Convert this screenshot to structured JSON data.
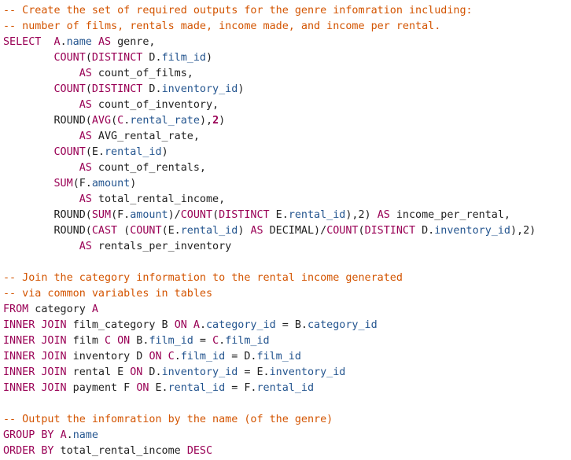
{
  "colors": {
    "keyword": "#990055",
    "comment": "#d35400",
    "field": "#24558f",
    "plain": "#1f1f1f",
    "background": "#ffffff"
  },
  "lines": [
    [
      {
        "t": "cm",
        "v": "-- Create the set of required outputs for the genre infomration including:"
      }
    ],
    [
      {
        "t": "cm",
        "v": "-- number of films, rentals made, income made, and income per rental."
      }
    ],
    [
      {
        "t": "kw",
        "v": "SELECT"
      },
      {
        "t": "pl",
        "v": "  "
      },
      {
        "t": "al",
        "v": "A"
      },
      {
        "t": "pl",
        "v": "."
      },
      {
        "t": "fd",
        "v": "name"
      },
      {
        "t": "pl",
        "v": " "
      },
      {
        "t": "kw",
        "v": "AS"
      },
      {
        "t": "pl",
        "v": " genre,"
      }
    ],
    [
      {
        "t": "pl",
        "v": "        "
      },
      {
        "t": "kw",
        "v": "COUNT"
      },
      {
        "t": "pl",
        "v": "("
      },
      {
        "t": "kw",
        "v": "DISTINCT"
      },
      {
        "t": "pl",
        "v": " D."
      },
      {
        "t": "fd",
        "v": "film_id"
      },
      {
        "t": "pl",
        "v": ")"
      }
    ],
    [
      {
        "t": "pl",
        "v": "            "
      },
      {
        "t": "kw",
        "v": "AS"
      },
      {
        "t": "pl",
        "v": " count_of_films,"
      }
    ],
    [
      {
        "t": "pl",
        "v": "        "
      },
      {
        "t": "kw",
        "v": "COUNT"
      },
      {
        "t": "pl",
        "v": "("
      },
      {
        "t": "kw",
        "v": "DISTINCT"
      },
      {
        "t": "pl",
        "v": " D."
      },
      {
        "t": "fd",
        "v": "inventory_id"
      },
      {
        "t": "pl",
        "v": ")"
      }
    ],
    [
      {
        "t": "pl",
        "v": "            "
      },
      {
        "t": "kw",
        "v": "AS"
      },
      {
        "t": "pl",
        "v": " count_of_inventory,"
      }
    ],
    [
      {
        "t": "pl",
        "v": "        ROUND("
      },
      {
        "t": "kw",
        "v": "AVG"
      },
      {
        "t": "pl",
        "v": "("
      },
      {
        "t": "al",
        "v": "C"
      },
      {
        "t": "pl",
        "v": "."
      },
      {
        "t": "fd",
        "v": "rental_rate"
      },
      {
        "t": "pl",
        "v": "),"
      },
      {
        "t": "nm",
        "v": "2"
      },
      {
        "t": "pl",
        "v": ")"
      }
    ],
    [
      {
        "t": "pl",
        "v": "            "
      },
      {
        "t": "kw",
        "v": "AS"
      },
      {
        "t": "pl",
        "v": " AVG_rental_rate,"
      }
    ],
    [
      {
        "t": "pl",
        "v": "        "
      },
      {
        "t": "kw",
        "v": "COUNT"
      },
      {
        "t": "pl",
        "v": "(E."
      },
      {
        "t": "fd",
        "v": "rental_id"
      },
      {
        "t": "pl",
        "v": ")"
      }
    ],
    [
      {
        "t": "pl",
        "v": "            "
      },
      {
        "t": "kw",
        "v": "AS"
      },
      {
        "t": "pl",
        "v": " count_of_rentals,"
      }
    ],
    [
      {
        "t": "pl",
        "v": "        "
      },
      {
        "t": "kw",
        "v": "SUM"
      },
      {
        "t": "pl",
        "v": "(F."
      },
      {
        "t": "fd",
        "v": "amount"
      },
      {
        "t": "pl",
        "v": ")"
      }
    ],
    [
      {
        "t": "pl",
        "v": "            "
      },
      {
        "t": "kw",
        "v": "AS"
      },
      {
        "t": "pl",
        "v": " total_rental_income,"
      }
    ],
    [
      {
        "t": "pl",
        "v": "        ROUND("
      },
      {
        "t": "kw",
        "v": "SUM"
      },
      {
        "t": "pl",
        "v": "(F."
      },
      {
        "t": "fd",
        "v": "amount"
      },
      {
        "t": "pl",
        "v": ")/"
      },
      {
        "t": "kw",
        "v": "COUNT"
      },
      {
        "t": "pl",
        "v": "("
      },
      {
        "t": "kw",
        "v": "DISTINCT"
      },
      {
        "t": "pl",
        "v": " E."
      },
      {
        "t": "fd",
        "v": "rental_id"
      },
      {
        "t": "pl",
        "v": "),2) "
      },
      {
        "t": "kw",
        "v": "AS"
      },
      {
        "t": "pl",
        "v": " income_per_rental,"
      }
    ],
    [
      {
        "t": "pl",
        "v": "        ROUND("
      },
      {
        "t": "kw",
        "v": "CAST"
      },
      {
        "t": "pl",
        "v": " ("
      },
      {
        "t": "kw",
        "v": "COUNT"
      },
      {
        "t": "pl",
        "v": "(E."
      },
      {
        "t": "fd",
        "v": "rental_id"
      },
      {
        "t": "pl",
        "v": ") "
      },
      {
        "t": "kw",
        "v": "AS"
      },
      {
        "t": "pl",
        "v": " DECIMAL)/"
      },
      {
        "t": "kw",
        "v": "COUNT"
      },
      {
        "t": "pl",
        "v": "("
      },
      {
        "t": "kw",
        "v": "DISTINCT"
      },
      {
        "t": "pl",
        "v": " D."
      },
      {
        "t": "fd",
        "v": "inventory_id"
      },
      {
        "t": "pl",
        "v": "),2)"
      }
    ],
    [
      {
        "t": "pl",
        "v": "            "
      },
      {
        "t": "kw",
        "v": "AS"
      },
      {
        "t": "pl",
        "v": " rentals_per_inventory"
      }
    ],
    [],
    [
      {
        "t": "cm",
        "v": "-- Join the category information to the rental income generated"
      }
    ],
    [
      {
        "t": "cm",
        "v": "-- via common variables in tables"
      }
    ],
    [
      {
        "t": "kw",
        "v": "FROM"
      },
      {
        "t": "pl",
        "v": " category "
      },
      {
        "t": "kw",
        "v": "A"
      }
    ],
    [
      {
        "t": "kw",
        "v": "INNER JOIN"
      },
      {
        "t": "pl",
        "v": " film_category B "
      },
      {
        "t": "kw",
        "v": "ON"
      },
      {
        "t": "pl",
        "v": " "
      },
      {
        "t": "al",
        "v": "A"
      },
      {
        "t": "pl",
        "v": "."
      },
      {
        "t": "fd",
        "v": "category_id"
      },
      {
        "t": "pl",
        "v": " = B."
      },
      {
        "t": "fd",
        "v": "category_id"
      }
    ],
    [
      {
        "t": "kw",
        "v": "INNER JOIN"
      },
      {
        "t": "pl",
        "v": " film "
      },
      {
        "t": "kw",
        "v": "C"
      },
      {
        "t": "pl",
        "v": " "
      },
      {
        "t": "kw",
        "v": "ON"
      },
      {
        "t": "pl",
        "v": " B."
      },
      {
        "t": "fd",
        "v": "film_id"
      },
      {
        "t": "pl",
        "v": " = "
      },
      {
        "t": "al",
        "v": "C"
      },
      {
        "t": "pl",
        "v": "."
      },
      {
        "t": "fd",
        "v": "film_id"
      }
    ],
    [
      {
        "t": "kw",
        "v": "INNER JOIN"
      },
      {
        "t": "pl",
        "v": " inventory D "
      },
      {
        "t": "kw",
        "v": "ON"
      },
      {
        "t": "pl",
        "v": " "
      },
      {
        "t": "al",
        "v": "C"
      },
      {
        "t": "pl",
        "v": "."
      },
      {
        "t": "fd",
        "v": "film_id"
      },
      {
        "t": "pl",
        "v": " = D."
      },
      {
        "t": "fd",
        "v": "film_id"
      }
    ],
    [
      {
        "t": "kw",
        "v": "INNER JOIN"
      },
      {
        "t": "pl",
        "v": " rental E "
      },
      {
        "t": "kw",
        "v": "ON"
      },
      {
        "t": "pl",
        "v": " D."
      },
      {
        "t": "fd",
        "v": "inventory_id"
      },
      {
        "t": "pl",
        "v": " = E."
      },
      {
        "t": "fd",
        "v": "inventory_id"
      }
    ],
    [
      {
        "t": "kw",
        "v": "INNER JOIN"
      },
      {
        "t": "pl",
        "v": " payment F "
      },
      {
        "t": "kw",
        "v": "ON"
      },
      {
        "t": "pl",
        "v": " E."
      },
      {
        "t": "fd",
        "v": "rental_id"
      },
      {
        "t": "pl",
        "v": " = F."
      },
      {
        "t": "fd",
        "v": "rental_id"
      }
    ],
    [],
    [
      {
        "t": "cm",
        "v": "-- Output the infomration by the name (of the genre)"
      }
    ],
    [
      {
        "t": "kw",
        "v": "GROUP BY"
      },
      {
        "t": "pl",
        "v": " "
      },
      {
        "t": "al",
        "v": "A"
      },
      {
        "t": "pl",
        "v": "."
      },
      {
        "t": "fd",
        "v": "name"
      }
    ],
    [
      {
        "t": "kw",
        "v": "ORDER BY"
      },
      {
        "t": "pl",
        "v": " total_rental_income "
      },
      {
        "t": "kw",
        "v": "DESC"
      }
    ]
  ]
}
